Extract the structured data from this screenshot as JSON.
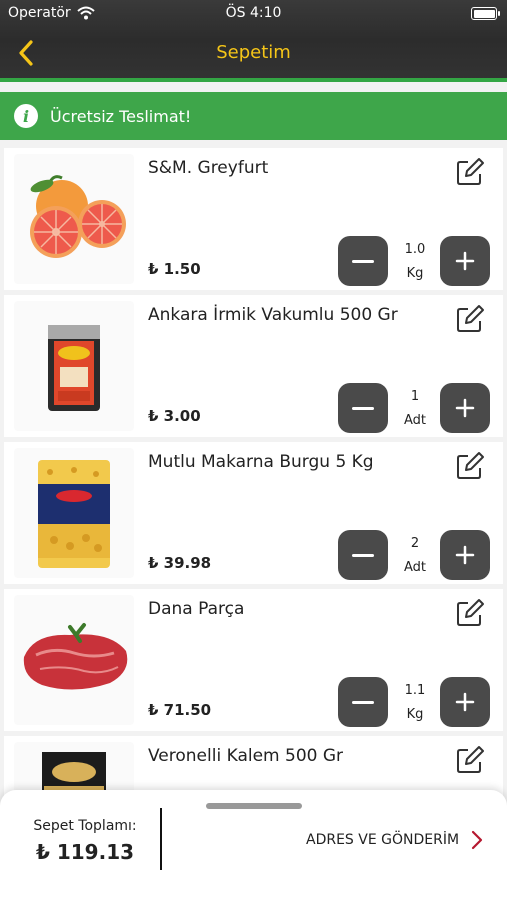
{
  "status_bar": {
    "carrier": "Operatör",
    "time": "ÖS 4:10"
  },
  "nav": {
    "title": "Sepetim",
    "back_icon": "chevron-left-icon"
  },
  "banner": {
    "text": "Ücretsiz Teslimat!",
    "icon": "info-icon"
  },
  "items": [
    {
      "name": "S&M. Greyfurt",
      "price": "₺ 1.50",
      "qty": "1.0",
      "unit": "Kg"
    },
    {
      "name": "Ankara İrmik Vakumlu 500 Gr",
      "price": "₺ 3.00",
      "qty": "1",
      "unit": "Adt"
    },
    {
      "name": "Mutlu Makarna Burgu 5 Kg",
      "price": "₺ 39.98",
      "qty": "2",
      "unit": "Adt"
    },
    {
      "name": "Dana Parça",
      "price": "₺ 71.50",
      "qty": "1.1",
      "unit": "Kg"
    },
    {
      "name": "Veronelli Kalem 500 Gr",
      "price": "",
      "qty": "",
      "unit": ""
    }
  ],
  "cart": {
    "total_label": "Sepet Toplamı:",
    "total_value": "₺ 119.13",
    "checkout_label": "ADRES VE GÖNDERİM"
  },
  "colors": {
    "accent": "#f5c518",
    "green": "#3ea64a",
    "button": "#4a4a4a",
    "checkout_arrow": "#b5182f"
  }
}
